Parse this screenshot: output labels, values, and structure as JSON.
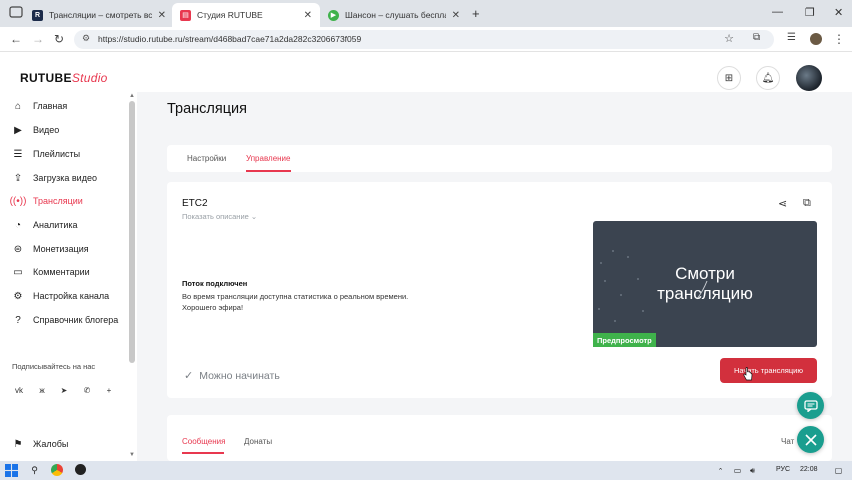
{
  "browser": {
    "tabs": [
      {
        "label": "Трансляции – смотреть все в…",
        "favicon": "rutube-icon",
        "color": "#1c2b4a"
      },
      {
        "label": "Студия RUTUBE",
        "favicon": "rutube-studio-icon",
        "color": "#e8384f"
      },
      {
        "label": "Шансон – слушать бесплат…",
        "favicon": "play-icon",
        "color": "#3fb24b"
      }
    ],
    "url": "https://studio.rutube.ru/stream/d468bad7cae71a2da282c3206673f059"
  },
  "app": {
    "logo_main": "RUTUBE",
    "logo_sub": "Studio"
  },
  "sidebar": {
    "items": [
      {
        "label": "Главная",
        "icon": "home-icon"
      },
      {
        "label": "Видео",
        "icon": "video-icon"
      },
      {
        "label": "Плейлисты",
        "icon": "playlist-icon"
      },
      {
        "label": "Загрузка видео",
        "icon": "upload-icon"
      },
      {
        "label": "Трансляции",
        "icon": "broadcast-icon",
        "active": true
      },
      {
        "label": "Аналитика",
        "icon": "analytics-icon"
      },
      {
        "label": "Монетизация",
        "icon": "monetization-icon"
      },
      {
        "label": "Комментарии",
        "icon": "comments-icon"
      },
      {
        "label": "Настройка канала",
        "icon": "gear-icon"
      },
      {
        "label": "Справочник блогера",
        "icon": "book-icon"
      }
    ],
    "social_title": "Подписывайтесь на нас",
    "social": [
      "vk-icon",
      "ok-icon",
      "telegram-icon",
      "viber-icon",
      "more-icon"
    ],
    "complaints": "Жалобы"
  },
  "main": {
    "title": "Трансляция",
    "tabs": [
      "Настройки",
      "Управление"
    ],
    "active_tab": 1,
    "stream": {
      "name": "ETC2",
      "show_description": "Показать описание",
      "status_title": "Поток подключен",
      "status_text": "Во время трансляции доступна статистика о реальном времени. Хорошего эфира!",
      "preview_text": "Смотри трансляцию",
      "preview_badge": "Предпросмотр",
      "ready_label": "Можно начинать",
      "start_button": "Начать трансляцию"
    },
    "chat_tabs": [
      "Сообщения",
      "Донаты"
    ],
    "chat_label": "Чат"
  },
  "taskbar": {
    "lang": "РУС",
    "time": "22:08"
  },
  "colors": {
    "accent": "#e8384f",
    "start_button": "#d2303d",
    "badge": "#3fb24b",
    "fab": "#1a9e8f"
  }
}
